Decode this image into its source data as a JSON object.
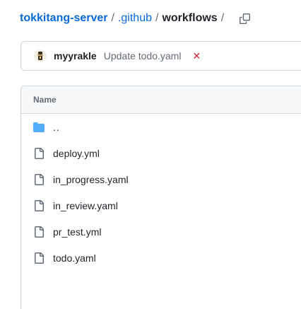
{
  "breadcrumb": {
    "repo": "tokkitang-server",
    "folder": ".github",
    "current": "workflows",
    "separator": "/"
  },
  "commit": {
    "author": "myyrakle",
    "message": "Update todo.yaml",
    "status": "✕",
    "status_color": "#cf222e"
  },
  "table": {
    "header": "Name",
    "parent_label": "..",
    "files": [
      "deploy.yml",
      "in_progress.yaml",
      "in_review.yaml",
      "pr_test.yml",
      "todo.yaml"
    ]
  },
  "colors": {
    "link": "#0969da",
    "folder": "#54aeff",
    "muted": "#636c76",
    "border": "#d0d7de"
  },
  "icons": {
    "copy": "copy-icon",
    "folder": "folder-icon",
    "file": "file-icon"
  }
}
